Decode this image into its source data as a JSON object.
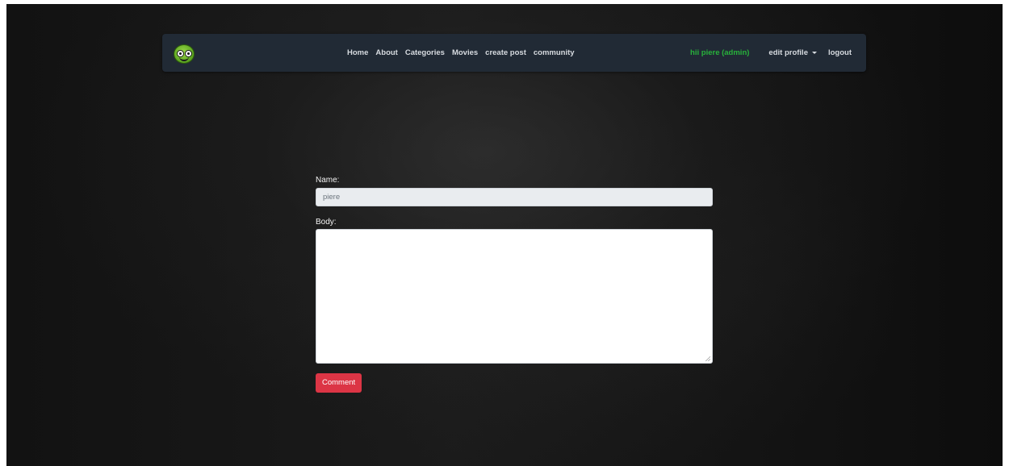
{
  "nav": {
    "logo_icon": "smiley-face-logo-icon",
    "links": [
      "Home",
      "About",
      "Categories",
      "Movies",
      "create post",
      "community"
    ],
    "greeting": "hii piere (admin)",
    "edit_profile": "edit profile",
    "logout": "logout"
  },
  "form": {
    "name_label": "Name:",
    "name_value": "piere",
    "body_label": "Body:",
    "body_value": "",
    "submit_label": "Comment"
  },
  "colors": {
    "navbar_bg": "#212a35",
    "greeting": "#28b23b",
    "submit_button": "#dc3545"
  }
}
